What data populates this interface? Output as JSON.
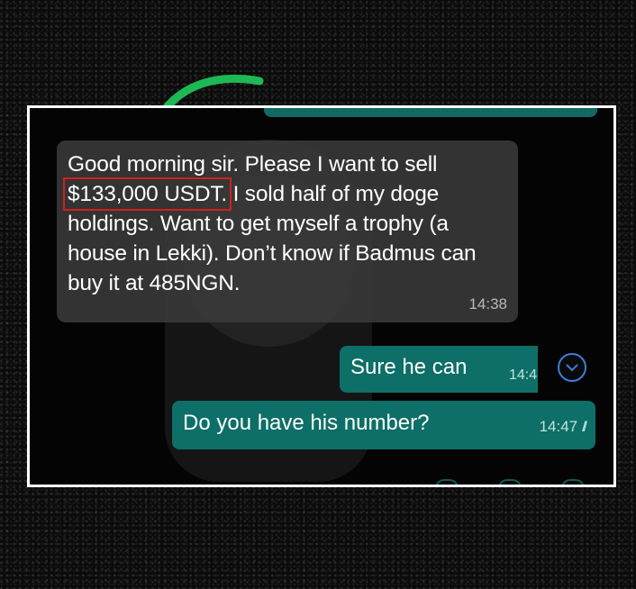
{
  "chat": {
    "incoming": {
      "text_before": "Good morning sir. Please I want to sell",
      "amount": "$133,000 USDT.",
      "text_after": "I sold half of my doge holdings. Want to get myself a trophy (a house in Lekki). Don’t know if Badmus can buy it at 485NGN.",
      "time": "14:38"
    },
    "outgoing": [
      {
        "text": "Sure he can",
        "time": "14:4"
      },
      {
        "text": "Do you have his number?",
        "time": "14:47"
      }
    ]
  },
  "icons": {
    "scroll_down": "chevron-down-icon",
    "read_receipt": "double-check-icon",
    "annotation_arrow": "curved-arrow-icon"
  },
  "colors": {
    "outgoing_bubble": "#0d6f67",
    "incoming_bubble": "#3a3a3a",
    "highlight_box": "#d11f1f",
    "arrow": "#1db954",
    "frame_border": "#ffffff"
  }
}
